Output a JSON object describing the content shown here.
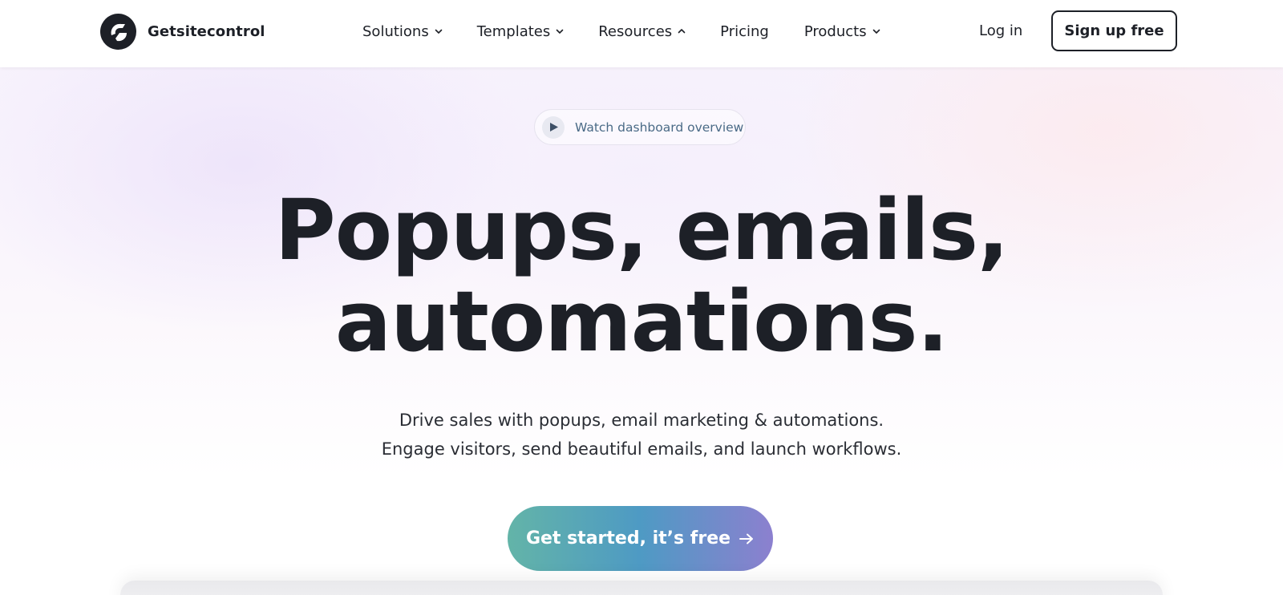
{
  "header": {
    "logo_text": "Getsitecontrol",
    "nav": [
      {
        "label": "Solutions",
        "chevron": "down"
      },
      {
        "label": "Templates",
        "chevron": "down"
      },
      {
        "label": "Resources",
        "chevron": "up"
      },
      {
        "label": "Pricing",
        "chevron": null
      },
      {
        "label": "Products",
        "chevron": "down"
      }
    ],
    "login_label": "Log in",
    "signup_label": "Sign up free"
  },
  "hero": {
    "watch_label": "Watch dashboard overview",
    "headline_lines": [
      "Popups, emails,",
      "automations."
    ],
    "subtext_lines": [
      "Drive sales with popups, email marketing & automations.",
      "Engage visitors, send beautiful emails, and launch workflows."
    ],
    "cta_label": "Get started, it’s free"
  },
  "colors": {
    "text_dark": "#1d2027",
    "watch_text": "#4a6a86",
    "cta_gradient": [
      "#63b4a8",
      "#4e9ac4",
      "#8c80cf"
    ]
  },
  "icons": {
    "logo": "getsitecontrol-logo-icon",
    "nav_chevrons": [
      "chevron-down-icon",
      "chevron-down-icon",
      "chevron-up-icon",
      "chevron-down-icon"
    ],
    "watch": "play-icon",
    "cta": "arrow-right-icon"
  }
}
